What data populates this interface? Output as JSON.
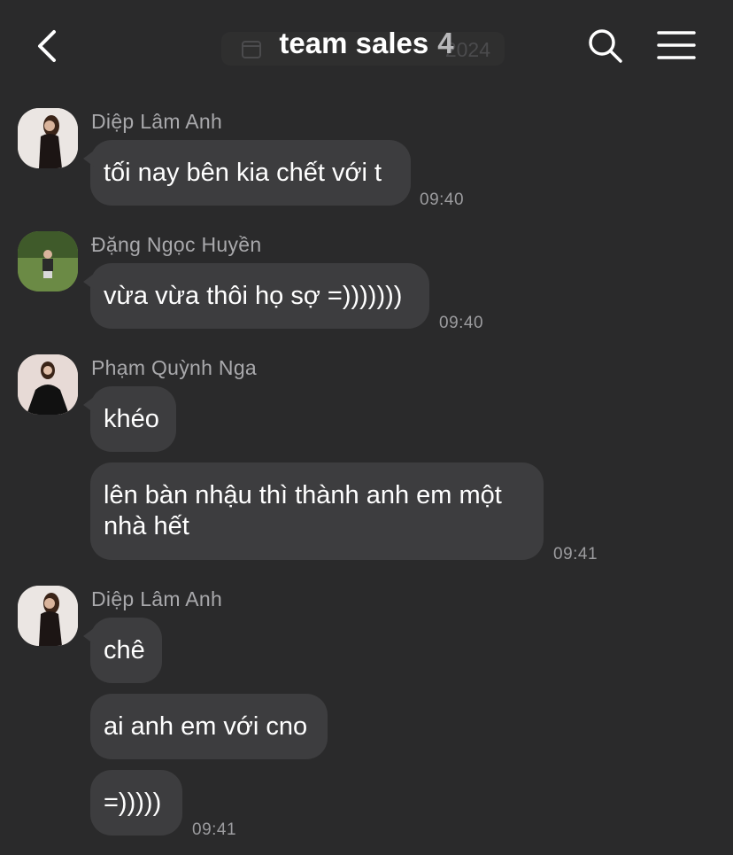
{
  "header": {
    "title": "team sales",
    "member_count": "4",
    "date_partial": "2024",
    "icons": {
      "back": "chevron-left-icon",
      "search": "search-icon",
      "menu": "menu-icon",
      "calendar": "calendar-icon"
    }
  },
  "messages": [
    {
      "sender": "Diệp Lâm Anh",
      "bubbles": [
        "tối nay bên kia chết với t"
      ],
      "time": "09:40"
    },
    {
      "sender": "Đặng Ngọc Huyền",
      "bubbles": [
        "vừa vừa thôi họ sợ =)))))))"
      ],
      "time": "09:40"
    },
    {
      "sender": "Phạm Quỳnh Nga",
      "bubbles": [
        "khéo",
        "lên bàn nhậu thì thành anh em một",
        "nhà hết"
      ],
      "time": "09:41"
    },
    {
      "sender": "Diệp Lâm Anh",
      "bubbles": [
        "chê",
        "ai anh em với cno",
        "=)))))"
      ],
      "time": "09:41"
    }
  ],
  "colors": {
    "background": "#2a2a2b",
    "bubble": "#3d3d3f",
    "sender": "#a9a9ac",
    "time": "#9c9c9f"
  }
}
